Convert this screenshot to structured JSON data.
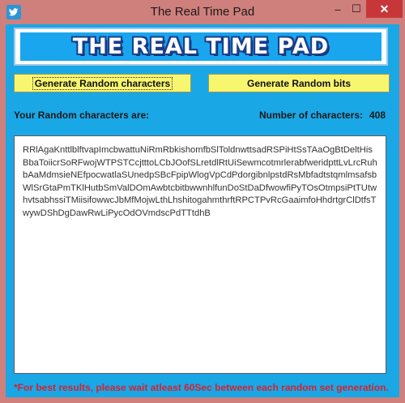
{
  "window": {
    "title": "The Real Time Pad",
    "app_icon": "bird-icon",
    "controls": {
      "minimize": "–",
      "maximize": "☐",
      "close": "✕"
    }
  },
  "banner": {
    "text": "THE REAL TIME PAD"
  },
  "buttons": {
    "generate_characters": "Generate Random characters",
    "generate_bits": "Generate Random bits"
  },
  "labels": {
    "random_characters": "Your Random characters are:",
    "number_of_characters": "Number of characters:",
    "count": "408"
  },
  "output": {
    "text": "RRlAgaKnttlblftvapImcbwattuNiRmRbkishomfbSlToldnwttsadRSPiHtSsTAaOgBtDeltHisBbaToiicrSoRFwojWTPSTCcjtttoLCbJOofSLretdlRtUiSewmcotmrlerabfweridpttLvLrcRuhbAaMdmsieNEfpocwatlaSUnedpSBcFpipWlogVpCdPdorgibnlpstdRsMbfadtstqmlmsafsbWlSrGtaPmTKlHutbSmValDOmAwbtcbitbwwnhlfunDoStDaDfwowfiPyTOsOtmpsiPtTUtwhvtsabhssiTMiisifowwcJbMfMojwLthLhshitogahmthrftRPCTPvRcGaaimfoHhdrtgrClDtfsTwywDShDgDawRwLiPycOdOVmdscPdTTtdhB"
  },
  "footer": {
    "note": "*For best results, please wait atleast 60Sec between each random set generation."
  },
  "colors": {
    "frame": "#cf7f7c",
    "client_bg": "#1aa7e6",
    "button_bg": "#f8f56f",
    "warning_text": "#d3232e",
    "banner_text_outline": "#1b3f8f"
  }
}
